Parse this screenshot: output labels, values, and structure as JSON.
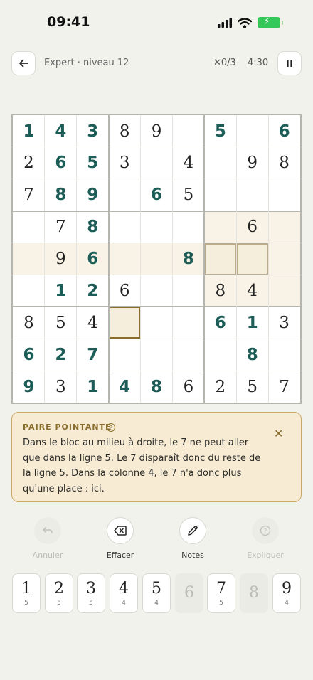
{
  "status": {
    "time": "09:41"
  },
  "header": {
    "level": "Expert · niveau 12",
    "mistakes": "0/3",
    "timer": "4:30"
  },
  "grid": {
    "rows": [
      [
        {
          "v": "1",
          "t": "e"
        },
        {
          "v": "4",
          "t": "e"
        },
        {
          "v": "3",
          "t": "e"
        },
        {
          "v": "8",
          "t": "g"
        },
        {
          "v": "9",
          "t": "g"
        },
        {
          "v": "",
          "t": ""
        },
        {
          "v": "5",
          "t": "e"
        },
        {
          "v": "",
          "t": ""
        },
        {
          "v": "6",
          "t": "e"
        }
      ],
      [
        {
          "v": "2",
          "t": "g"
        },
        {
          "v": "6",
          "t": "e"
        },
        {
          "v": "5",
          "t": "e"
        },
        {
          "v": "3",
          "t": "g"
        },
        {
          "v": "",
          "t": ""
        },
        {
          "v": "4",
          "t": "g"
        },
        {
          "v": "",
          "t": ""
        },
        {
          "v": "9",
          "t": "g"
        },
        {
          "v": "8",
          "t": "g"
        }
      ],
      [
        {
          "v": "7",
          "t": "g"
        },
        {
          "v": "8",
          "t": "e"
        },
        {
          "v": "9",
          "t": "e"
        },
        {
          "v": "",
          "t": ""
        },
        {
          "v": "6",
          "t": "e"
        },
        {
          "v": "5",
          "t": "g"
        },
        {
          "v": "",
          "t": ""
        },
        {
          "v": "",
          "t": ""
        },
        {
          "v": "",
          "t": ""
        }
      ],
      [
        {
          "v": "",
          "t": ""
        },
        {
          "v": "7",
          "t": "g"
        },
        {
          "v": "8",
          "t": "e"
        },
        {
          "v": "",
          "t": ""
        },
        {
          "v": "",
          "t": ""
        },
        {
          "v": "",
          "t": ""
        },
        {
          "v": "",
          "t": ""
        },
        {
          "v": "6",
          "t": "g"
        },
        {
          "v": "",
          "t": ""
        }
      ],
      [
        {
          "v": "",
          "t": ""
        },
        {
          "v": "9",
          "t": "g"
        },
        {
          "v": "6",
          "t": "e"
        },
        {
          "v": "",
          "t": ""
        },
        {
          "v": "",
          "t": ""
        },
        {
          "v": "8",
          "t": "e"
        },
        {
          "v": "",
          "t": ""
        },
        {
          "v": "",
          "t": ""
        },
        {
          "v": "",
          "t": ""
        }
      ],
      [
        {
          "v": "",
          "t": ""
        },
        {
          "v": "1",
          "t": "e"
        },
        {
          "v": "2",
          "t": "e"
        },
        {
          "v": "6",
          "t": "g"
        },
        {
          "v": "",
          "t": ""
        },
        {
          "v": "",
          "t": ""
        },
        {
          "v": "8",
          "t": "g"
        },
        {
          "v": "4",
          "t": "g"
        },
        {
          "v": "",
          "t": ""
        }
      ],
      [
        {
          "v": "8",
          "t": "g"
        },
        {
          "v": "5",
          "t": "g"
        },
        {
          "v": "4",
          "t": "g"
        },
        {
          "v": "",
          "t": ""
        },
        {
          "v": "",
          "t": ""
        },
        {
          "v": "",
          "t": ""
        },
        {
          "v": "6",
          "t": "e"
        },
        {
          "v": "1",
          "t": "e"
        },
        {
          "v": "3",
          "t": "g"
        }
      ],
      [
        {
          "v": "6",
          "t": "e"
        },
        {
          "v": "2",
          "t": "e"
        },
        {
          "v": "7",
          "t": "e"
        },
        {
          "v": "",
          "t": ""
        },
        {
          "v": "",
          "t": ""
        },
        {
          "v": "",
          "t": ""
        },
        {
          "v": "",
          "t": ""
        },
        {
          "v": "8",
          "t": "e"
        },
        {
          "v": "",
          "t": ""
        }
      ],
      [
        {
          "v": "9",
          "t": "e"
        },
        {
          "v": "3",
          "t": "g"
        },
        {
          "v": "1",
          "t": "e"
        },
        {
          "v": "4",
          "t": "e"
        },
        {
          "v": "8",
          "t": "e"
        },
        {
          "v": "6",
          "t": "g"
        },
        {
          "v": "2",
          "t": "g"
        },
        {
          "v": "5",
          "t": "g"
        },
        {
          "v": "7",
          "t": "g"
        }
      ]
    ],
    "highlighted_cells": [
      [
        3,
        6
      ],
      [
        3,
        7
      ],
      [
        3,
        8
      ],
      [
        4,
        0
      ],
      [
        4,
        1
      ],
      [
        4,
        2
      ],
      [
        4,
        3
      ],
      [
        4,
        4
      ],
      [
        4,
        5
      ],
      [
        4,
        8
      ],
      [
        5,
        6
      ],
      [
        5,
        7
      ],
      [
        5,
        8
      ]
    ],
    "pointing_pair_cells": [
      [
        4,
        6
      ],
      [
        4,
        7
      ]
    ],
    "selected_cell": [
      6,
      3
    ]
  },
  "hint": {
    "title": "PAIRE POINTANTE",
    "text_lines": [
      "Dans le bloc au milieu à droite, le 7 ne peut aller",
      "que dans la ligne 5. Le 7 disparaît donc du reste de",
      "la ligne 5. Dans la colonne 4, le 7 n'a donc plus",
      "qu'une place : ici."
    ]
  },
  "tools": [
    {
      "label": "Annuler",
      "icon": "undo-icon",
      "enabled": false
    },
    {
      "label": "Effacer",
      "icon": "eraser-icon",
      "enabled": true
    },
    {
      "label": "Notes",
      "icon": "pencil-icon",
      "enabled": true
    },
    {
      "label": "Expliquer",
      "icon": "help-icon",
      "enabled": false
    }
  ],
  "keypad": [
    {
      "digit": "1",
      "remaining": "5",
      "enabled": true
    },
    {
      "digit": "2",
      "remaining": "5",
      "enabled": true
    },
    {
      "digit": "3",
      "remaining": "5",
      "enabled": true
    },
    {
      "digit": "4",
      "remaining": "4",
      "enabled": true
    },
    {
      "digit": "5",
      "remaining": "4",
      "enabled": true
    },
    {
      "digit": "6",
      "remaining": "",
      "enabled": false
    },
    {
      "digit": "7",
      "remaining": "5",
      "enabled": true
    },
    {
      "digit": "8",
      "remaining": "",
      "enabled": false
    },
    {
      "digit": "9",
      "remaining": "4",
      "enabled": true
    }
  ],
  "colors": {
    "entered_digit": "#1c5e57",
    "given_digit": "#222222",
    "accent_gold": "#8a6d2c",
    "hint_background": "#f7ecd3",
    "battery_green": "#34c759"
  }
}
